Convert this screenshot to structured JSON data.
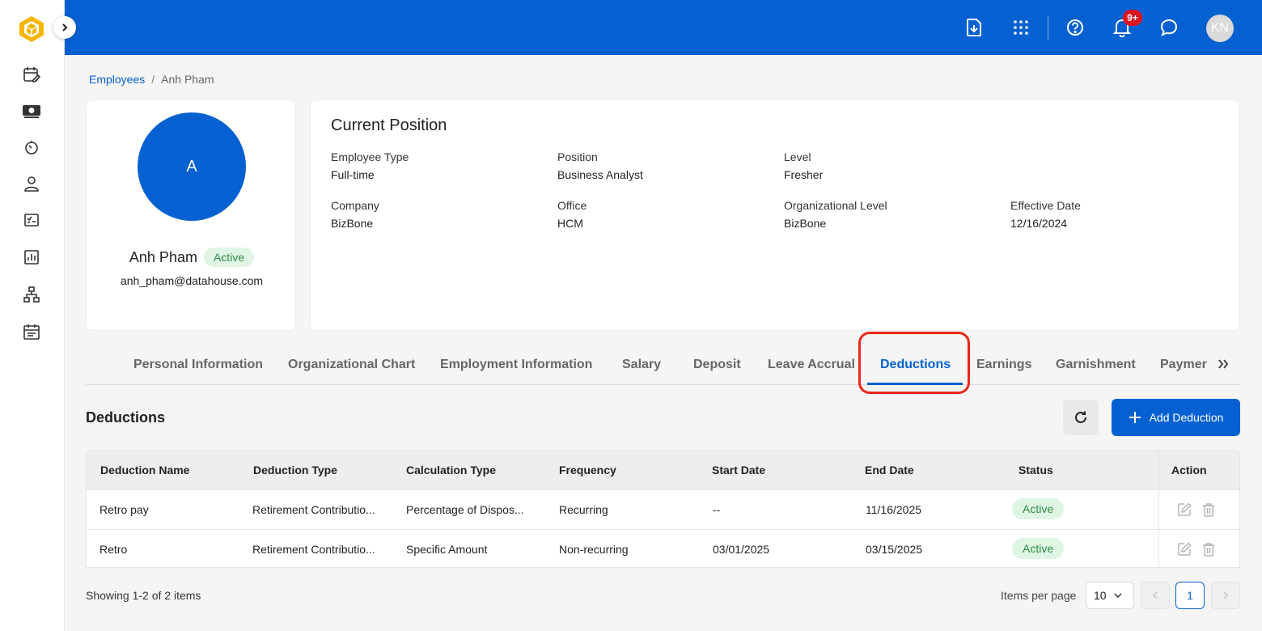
{
  "topbar": {
    "notification_count": "9+",
    "user_initials": "KN"
  },
  "breadcrumb": {
    "parent": "Employees",
    "separator": "/",
    "current": "Anh Pham"
  },
  "profile": {
    "avatar_letter": "A",
    "name": "Anh Pham",
    "status": "Active",
    "email": "anh_pham@datahouse.com"
  },
  "position": {
    "title": "Current Position",
    "fields": [
      {
        "label": "Employee Type",
        "value": "Full-time"
      },
      {
        "label": "Position",
        "value": "Business Analyst"
      },
      {
        "label": "Level",
        "value": "Fresher"
      },
      {
        "label": "Company",
        "value": "BizBone"
      },
      {
        "label": "Office",
        "value": "HCM"
      },
      {
        "label": "Organizational Level",
        "value": "BizBone"
      },
      {
        "label": "Effective Date",
        "value": "12/16/2024"
      }
    ]
  },
  "tabs": [
    "Personal Information",
    "Organizational Chart",
    "Employment Information",
    "Salary",
    "Deposit",
    "Leave Accrual",
    "Deductions",
    "Earnings",
    "Garnishment",
    "Paymer"
  ],
  "active_tab": "Deductions",
  "section": {
    "title": "Deductions",
    "add_label": "Add Deduction"
  },
  "table": {
    "headers": [
      "Deduction Name",
      "Deduction Type",
      "Calculation Type",
      "Frequency",
      "Start Date",
      "End Date",
      "Status",
      "Action"
    ],
    "rows": [
      {
        "name": "Retro pay",
        "type": "Retirement Contributio...",
        "calc": "Percentage of Dispos...",
        "frequency": "Recurring",
        "start": "--",
        "end": "11/16/2025",
        "status": "Active"
      },
      {
        "name": "Retro",
        "type": "Retirement Contributio...",
        "calc": "Specific Amount",
        "frequency": "Non-recurring",
        "start": "03/01/2025",
        "end": "03/15/2025",
        "status": "Active"
      }
    ]
  },
  "footer": {
    "showing": "Showing 1-2 of 2 items",
    "items_per_page_label": "Items per page",
    "items_per_page": "10",
    "current_page": "1"
  },
  "colors": {
    "brand": "#0561d1",
    "active_badge_bg": "#e1f5e5",
    "active_badge_text": "#2e8b46",
    "highlight": "#e8281a"
  }
}
